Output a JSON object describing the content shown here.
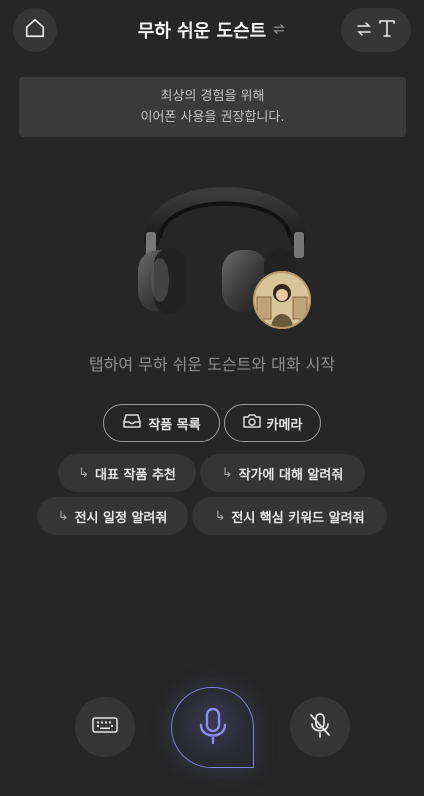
{
  "header": {
    "title": "무하 쉬운 도슨트",
    "home_icon": "home-icon",
    "swap_icon": "swap-icon",
    "text_mode_icon": "text-mode-icon"
  },
  "notice": {
    "line1": "최상의 경험을 위해",
    "line2": "이어폰 사용을 권장합니다."
  },
  "hero": {
    "image": "headphones-illustration",
    "avatar": "docent-avatar"
  },
  "tap_prompt": "탭하여 무하 쉬운 도슨트와 대화 시작",
  "actions": [
    {
      "label": "작품 목록",
      "icon": "inbox-icon"
    },
    {
      "label": "카메라",
      "icon": "camera-icon"
    }
  ],
  "suggestions": [
    {
      "label": "대표 작품 추천",
      "arrow": "↳"
    },
    {
      "label": "작가에 대해 알려줘",
      "arrow": "↳"
    },
    {
      "label": "전시 일정 알려줘",
      "arrow": "↳"
    },
    {
      "label": "전시 핵심 키워드 알려줘",
      "arrow": "↳"
    }
  ],
  "controls": {
    "keyboard_icon": "keyboard-icon",
    "mic_icon": "microphone-icon",
    "mic_off_icon": "microphone-off-icon"
  },
  "colors": {
    "background": "#262626",
    "accent": "#8a8cf0"
  }
}
